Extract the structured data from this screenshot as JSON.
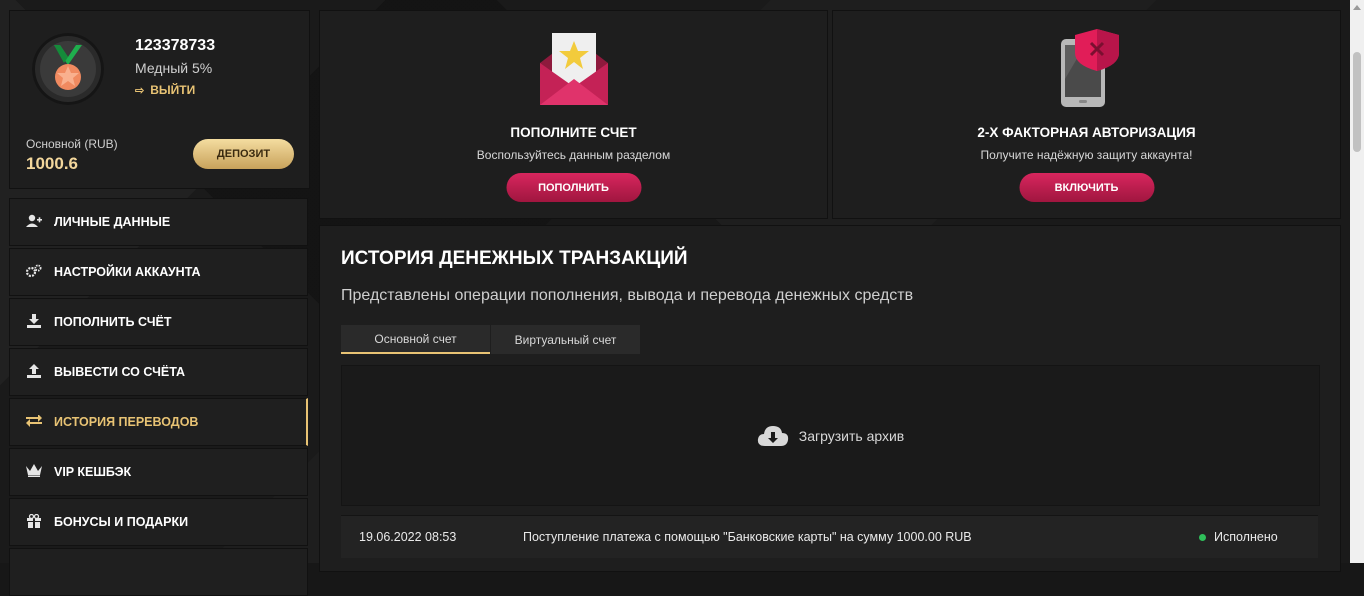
{
  "profile": {
    "user_id": "123378733",
    "level": "Медный 5%",
    "logout_label": "ВЫЙТИ",
    "balance_label": "Основной (RUB)",
    "balance_value": "1000.6",
    "deposit_label": "ДЕПОЗИТ"
  },
  "menu": {
    "items": [
      {
        "label": "ЛИЧНЫЕ ДАННЫЕ",
        "icon": "user-add-icon"
      },
      {
        "label": "НАСТРОЙКИ АККАУНТА",
        "icon": "gears-icon"
      },
      {
        "label": "ПОПОЛНИТЬ СЧЁТ",
        "icon": "download-icon"
      },
      {
        "label": "ВЫВЕСТИ СО СЧЁТА",
        "icon": "upload-icon"
      },
      {
        "label": "ИСТОРИЯ ПЕРЕВОДОВ",
        "icon": "transfer-arrows-icon",
        "active": true
      },
      {
        "label": "VIP КЕШБЭК",
        "icon": "crown-icon"
      },
      {
        "label": "БОНУСЫ И ПОДАРКИ",
        "icon": "gift-icon"
      }
    ]
  },
  "promo": {
    "deposit": {
      "title": "ПОПОЛНИТЕ СЧЕТ",
      "subtitle": "Воспользуйтесь данным разделом",
      "button": "ПОПОЛНИТЬ",
      "icon": "envelope-star-icon"
    },
    "twofa": {
      "title": "2-Х ФАКТОРНАЯ АВТОРИЗАЦИЯ",
      "subtitle": "Получите надёжную защиту аккаунта!",
      "button": "ВКЛЮЧИТЬ",
      "icon": "phone-shield-icon"
    }
  },
  "transactions": {
    "title": "ИСТОРИЯ ДЕНЕЖНЫХ ТРАНЗАКЦИЙ",
    "subtitle": "Представлены операции пополнения, вывода и перевода денежных средств",
    "tabs": [
      "Основной счет",
      "Виртуальный счет"
    ],
    "download_label": "Загрузить архив",
    "rows": [
      {
        "date": "19.06.2022 08:53",
        "description": "Поступление платежа с помощью \"Банковские карты\" на сумму 1000.00 RUB",
        "status": "Исполнено"
      }
    ]
  },
  "colors": {
    "accent_gold": "#e8c374",
    "accent_pink": "#c81e53",
    "status_success": "#2fbf5a"
  }
}
